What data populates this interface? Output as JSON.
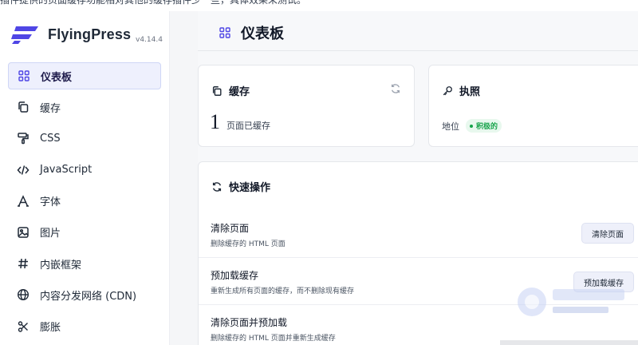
{
  "top_note": "插件提供的页面缓存功能相对其他的缓存插件少一些，具体效果未测试。",
  "brand": {
    "name": "FlyingPress",
    "version": "v4.14.4"
  },
  "sidebar": {
    "items": [
      {
        "label": "仪表板",
        "icon": "grid-icon",
        "active": true
      },
      {
        "label": "缓存",
        "icon": "copy-icon",
        "active": false
      },
      {
        "label": "CSS",
        "icon": "paint-roller-icon",
        "active": false
      },
      {
        "label": "JavaScript",
        "icon": "code-icon",
        "active": false
      },
      {
        "label": "字体",
        "icon": "font-icon",
        "active": false
      },
      {
        "label": "图片",
        "icon": "image-icon",
        "active": false
      },
      {
        "label": "内嵌框架",
        "icon": "hash-icon",
        "active": false
      },
      {
        "label": "内容分发网络 (CDN)",
        "icon": "globe-icon",
        "active": false
      },
      {
        "label": "膨胀",
        "icon": "scissors-icon",
        "active": false
      }
    ]
  },
  "header": {
    "title": "仪表板"
  },
  "cache_card": {
    "title": "缓存",
    "count": "1",
    "count_label": "页面已缓存"
  },
  "license_card": {
    "title": "执照",
    "status_label": "地位",
    "status_badge": "积极的",
    "status_color": "#16a34a"
  },
  "actions_card": {
    "title": "快速操作",
    "rows": [
      {
        "title": "清除页面",
        "description": "删除缓存的 HTML 页面",
        "button": "清除页面"
      },
      {
        "title": "预加载缓存",
        "description": "重新生成所有页面的缓存，而不删除现有缓存",
        "button": "预加载缓存"
      },
      {
        "title": "清除页面并预加载",
        "description": "删除缓存的 HTML 页面并重新生成缓存",
        "button": ""
      }
    ]
  },
  "colors": {
    "accent": "#4f46e5",
    "active_bg": "#eef0fd",
    "button_bg": "#eef0fa"
  }
}
